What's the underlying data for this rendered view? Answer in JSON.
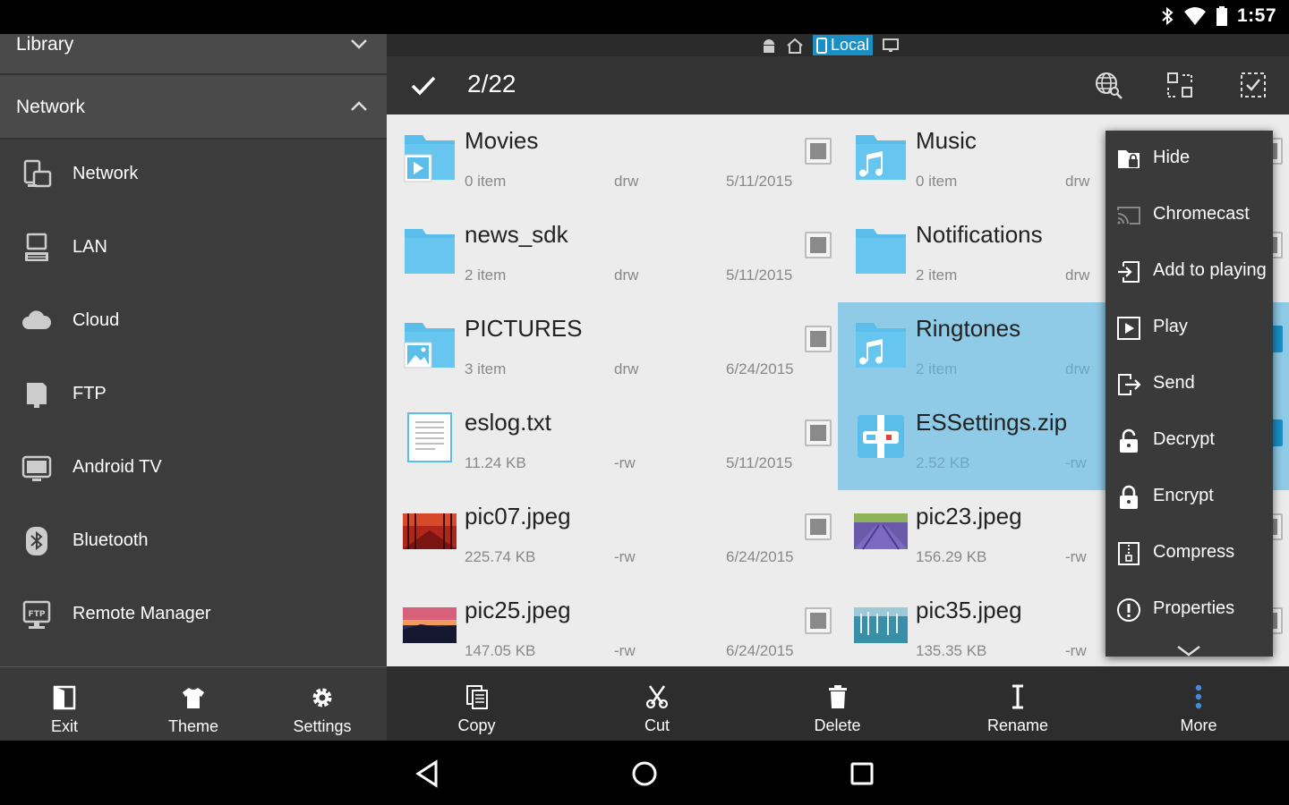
{
  "status_bar": {
    "time": "1:57",
    "icons": [
      "bluetooth-icon",
      "wifi-icon",
      "battery-icon"
    ]
  },
  "sidebar": {
    "library_label": "Library",
    "network_label": "Network",
    "items": [
      {
        "label": "Network",
        "icon": "network-icon"
      },
      {
        "label": "LAN",
        "icon": "lan-icon"
      },
      {
        "label": "Cloud",
        "icon": "cloud-icon"
      },
      {
        "label": "FTP",
        "icon": "ftp-icon"
      },
      {
        "label": "Android TV",
        "icon": "tv-icon"
      },
      {
        "label": "Bluetooth",
        "icon": "bluetooth-icon"
      },
      {
        "label": "Remote Manager",
        "icon": "remote-manager-icon"
      }
    ]
  },
  "path_bar": {
    "local_label": "Local"
  },
  "toolbar": {
    "selection_count": "2/22"
  },
  "files": [
    {
      "name": "Movies",
      "meta": "0 item",
      "perm": "drw",
      "date": "5/11/2015",
      "type": "folder-video",
      "selected": false
    },
    {
      "name": "Music",
      "meta": "0 item",
      "perm": "drw",
      "date": "",
      "type": "folder-music",
      "selected": false
    },
    {
      "name": "news_sdk",
      "meta": "2 item",
      "perm": "drw",
      "date": "5/11/2015",
      "type": "folder",
      "selected": false
    },
    {
      "name": "Notifications",
      "meta": "2 item",
      "perm": "drw",
      "date": "",
      "type": "folder",
      "selected": false
    },
    {
      "name": "PICTURES",
      "meta": "3 item",
      "perm": "drw",
      "date": "6/24/2015",
      "type": "folder-picture",
      "selected": false
    },
    {
      "name": "Ringtones",
      "meta": "2 item",
      "perm": "drw",
      "date": "",
      "type": "folder-music",
      "selected": true
    },
    {
      "name": "eslog.txt",
      "meta": "11.24 KB",
      "perm": "-rw",
      "date": "5/11/2015",
      "type": "text",
      "selected": false
    },
    {
      "name": "ESSettings.zip",
      "meta": "2.52 KB",
      "perm": "-rw",
      "date": "",
      "type": "zip",
      "selected": true
    },
    {
      "name": "pic07.jpeg",
      "meta": "225.74 KB",
      "perm": "-rw",
      "date": "6/24/2015",
      "type": "image-red",
      "selected": false
    },
    {
      "name": "pic23.jpeg",
      "meta": "156.29 KB",
      "perm": "-rw",
      "date": "",
      "type": "image-lavender",
      "selected": false
    },
    {
      "name": "pic25.jpeg",
      "meta": "147.05 KB",
      "perm": "-rw",
      "date": "6/24/2015",
      "type": "image-sunset",
      "selected": false
    },
    {
      "name": "pic35.jpeg",
      "meta": "135.35 KB",
      "perm": "-rw",
      "date": "",
      "type": "image-lake",
      "selected": false
    }
  ],
  "popup_menu": [
    {
      "label": "Hide",
      "icon": "hide-icon"
    },
    {
      "label": "Chromecast",
      "icon": "cast-icon"
    },
    {
      "label": "Add to playing",
      "icon": "add-to-playlist-icon"
    },
    {
      "label": "Play",
      "icon": "play-icon"
    },
    {
      "label": "Send",
      "icon": "send-icon"
    },
    {
      "label": "Decrypt",
      "icon": "unlock-icon"
    },
    {
      "label": "Encrypt",
      "icon": "lock-icon"
    },
    {
      "label": "Compress",
      "icon": "compress-icon"
    },
    {
      "label": "Properties",
      "icon": "info-icon"
    }
  ],
  "bottom_left": [
    {
      "label": "Exit",
      "icon": "exit-icon"
    },
    {
      "label": "Theme",
      "icon": "theme-icon"
    },
    {
      "label": "Settings",
      "icon": "gear-icon"
    }
  ],
  "bottom_right": [
    {
      "label": "Copy",
      "icon": "copy-icon"
    },
    {
      "label": "Cut",
      "icon": "cut-icon"
    },
    {
      "label": "Delete",
      "icon": "trash-icon"
    },
    {
      "label": "Rename",
      "icon": "rename-icon"
    },
    {
      "label": "More",
      "icon": "more-vert-icon"
    }
  ],
  "colors": {
    "accent": "#1a8fc6",
    "selected_row": "#8fcbe7",
    "sidebar_bg": "#3c3c3c",
    "grid_bg": "#ececec"
  }
}
